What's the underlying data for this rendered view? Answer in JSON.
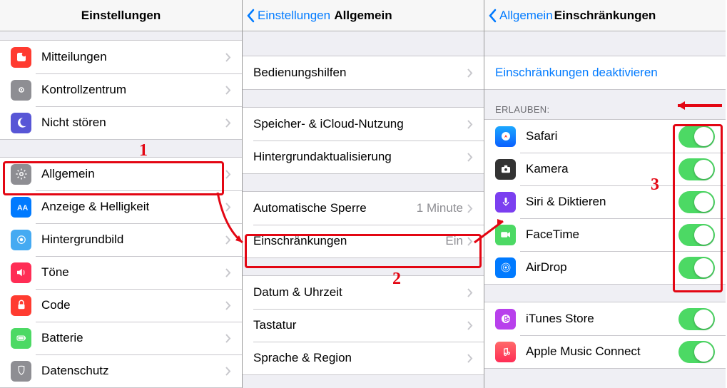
{
  "pane1": {
    "title": "Einstellungen",
    "items": [
      {
        "label": "Mitteilungen"
      },
      {
        "label": "Kontrollzentrum"
      },
      {
        "label": "Nicht stören"
      },
      {
        "label": "Allgemein"
      },
      {
        "label": "Anzeige & Helligkeit"
      },
      {
        "label": "Hintergrundbild"
      },
      {
        "label": "Töne"
      },
      {
        "label": "Code"
      },
      {
        "label": "Batterie"
      },
      {
        "label": "Datenschutz"
      }
    ]
  },
  "pane2": {
    "back": "Einstellungen",
    "title": "Allgemein",
    "groupA": [
      {
        "label": "Bedienungshilfen"
      }
    ],
    "groupB": [
      {
        "label": "Speicher- & iCloud-Nutzung"
      },
      {
        "label": "Hintergrundaktualisierung"
      }
    ],
    "groupC": [
      {
        "label": "Automatische Sperre",
        "value": "1 Minute"
      },
      {
        "label": "Einschränkungen",
        "value": "Ein"
      }
    ],
    "groupD": [
      {
        "label": "Datum & Uhrzeit"
      },
      {
        "label": "Tastatur"
      },
      {
        "label": "Sprache & Region"
      }
    ]
  },
  "pane3": {
    "back": "Allgemein",
    "title": "Einschränkungen",
    "deactivate": "Einschränkungen deaktivieren",
    "allow_header": "ERLAUBEN:",
    "allow": [
      {
        "label": "Safari"
      },
      {
        "label": "Kamera"
      },
      {
        "label": "Siri & Diktieren"
      },
      {
        "label": "FaceTime"
      },
      {
        "label": "AirDrop"
      }
    ],
    "extra": [
      {
        "label": "iTunes Store"
      },
      {
        "label": "Apple Music Connect"
      }
    ]
  },
  "annot": {
    "n1": "1",
    "n2": "2",
    "n3": "3"
  }
}
